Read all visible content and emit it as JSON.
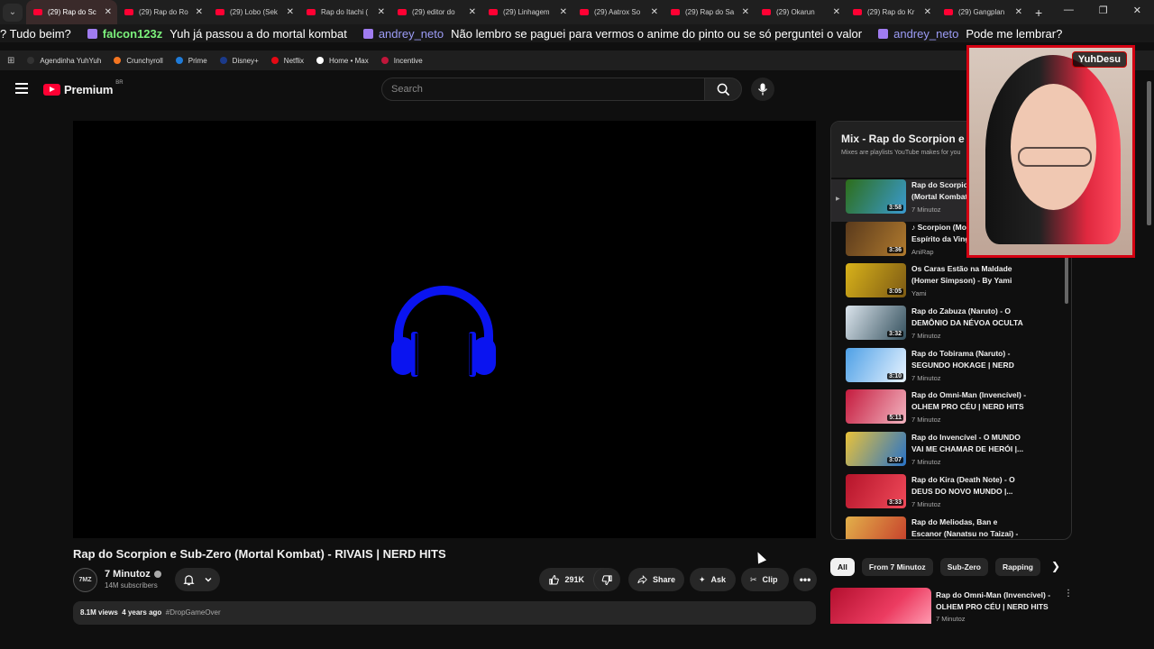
{
  "browser": {
    "tabs": [
      {
        "title": "(29) Rap do Sc",
        "active": true
      },
      {
        "title": "(29) Rap do Ro",
        "active": false
      },
      {
        "title": "(29) Lobo (Sek",
        "active": false
      },
      {
        "title": "Rap do Itachi (",
        "active": false
      },
      {
        "title": "(29) editor do",
        "active": false
      },
      {
        "title": "(29) Linhagem",
        "active": false
      },
      {
        "title": "(29) Aatrox So",
        "active": false
      },
      {
        "title": "(29) Rap do Sa",
        "active": false
      },
      {
        "title": "(29) Okarun",
        "active": false
      },
      {
        "title": "(29) Rap do Kr",
        "active": false
      },
      {
        "title": "(29) Gangplan",
        "active": false
      }
    ],
    "new_tab": "+",
    "url_ghost": "youtube.com/watch?v=...&list=...&start_radio=1",
    "bookmarks": [
      {
        "label": "Agendinha YuhYuh",
        "color": "#333333"
      },
      {
        "label": "Crunchyroll",
        "color": "#f47521"
      },
      {
        "label": "Prime",
        "color": "#1f7bd8"
      },
      {
        "label": "Disney+",
        "color": "#1b3a8a"
      },
      {
        "label": "Netflix",
        "color": "#e50914"
      },
      {
        "label": "Home • Max",
        "color": "#ffffff"
      },
      {
        "label": "Incentive",
        "color": "#c0163a"
      }
    ]
  },
  "ticker": {
    "lead": "? Tudo beim?",
    "messages": [
      {
        "user": "falcon123z",
        "text": "Yuh já passou a do mortal kombat",
        "style": "a"
      },
      {
        "user": "andrey_neto",
        "text": "Não lembro se paguei para vermos o anime do pinto ou se só perguntei o valor",
        "style": "b"
      },
      {
        "user": "andrey_neto",
        "text": "Pode me lembrar?",
        "style": "b"
      }
    ]
  },
  "youtube": {
    "logo_word": "Premium",
    "region": "BR",
    "search_placeholder": "Search",
    "video": {
      "title": "Rap do Scorpion e Sub-Zero (Mortal Kombat) - RIVAIS | NERD HITS",
      "channel": "7 Minutoz",
      "channel_avatar": "7MZ",
      "subscribers": "14M subscribers",
      "likes": "291K",
      "share": "Share",
      "ask": "Ask",
      "clip": "Clip",
      "views": "8.1M views",
      "age": "4 years ago",
      "hashtag": "#DropGameOver"
    },
    "mix": {
      "title": "Mix - Rap do Scorpion e Sub-Zero",
      "subtitle": "Mixes are playlists YouTube makes for you",
      "items": [
        {
          "title": "Rap do Scorpion e Sub-Zero (Mortal Kombat)",
          "channel": "7 Minutoz",
          "duration": "3:58",
          "active": true,
          "c1": "#2d6e1a",
          "c2": "#3a9ad0"
        },
        {
          "title": "♪ Scorpion (Mortal Kombat) | Espírito da Vingança",
          "channel": "AniRap",
          "duration": "3:36",
          "active": false,
          "c1": "#5a3a1c",
          "c2": "#b07a2e"
        },
        {
          "title": "Os Caras Estão na Maldade (Homer Simpson) - By Yami",
          "channel": "Yami",
          "duration": "3:05",
          "active": false,
          "c1": "#d8b21a",
          "c2": "#7d5a14"
        },
        {
          "title": "Rap do Zabuza (Naruto) - O DEMÔNIO DA NÉVOA OCULTA",
          "channel": "7 Minutoz",
          "duration": "3:32",
          "active": false,
          "c1": "#dbe4ec",
          "c2": "#35515e"
        },
        {
          "title": "Rap do Tobirama (Naruto) - SEGUNDO HOKAGE | NERD HITS",
          "channel": "7 Minutoz",
          "duration": "3:10",
          "active": false,
          "c1": "#4ea0e6",
          "c2": "#e8f3ff"
        },
        {
          "title": "Rap do Omni-Man (Invencível) - OLHEM PRO CÉU | NERD HITS",
          "channel": "7 Minutoz",
          "duration": "5:11",
          "active": false,
          "c1": "#c51b3e",
          "c2": "#f2b4c0"
        },
        {
          "title": "Rap do Invencível - O MUNDO VAI ME CHAMAR DE HERÓI |...",
          "channel": "7 Minutoz",
          "duration": "3:07",
          "active": false,
          "c1": "#e9c23a",
          "c2": "#2873c8"
        },
        {
          "title": "Rap do Kira (Death Note) - O DEUS DO NOVO MUNDO |...",
          "channel": "7 Minutoz",
          "duration": "3:33",
          "active": false,
          "c1": "#b5142a",
          "c2": "#f04a5a"
        },
        {
          "title": "Rap do Meliodas, Ban e Escanor (Nanatsu no Taizai) -",
          "channel": "7 Minutoz",
          "duration": "",
          "active": false,
          "c1": "#e2b04a",
          "c2": "#c53a2a"
        }
      ]
    },
    "chips": [
      "All",
      "From 7 Minutoz",
      "Sub-Zero",
      "Rapping"
    ],
    "recommendation": {
      "title": "Rap do Omni-Man (Invencível) - OLHEM PRO CÉU | NERD HITS",
      "channel": "7 Minutoz"
    }
  },
  "webcam": {
    "badge": "YuhDesu"
  },
  "colors": {
    "accent": "#ff0033",
    "background": "#0f0f0f",
    "headphones": "#0a14f0",
    "webcam_border": "#d40012"
  }
}
